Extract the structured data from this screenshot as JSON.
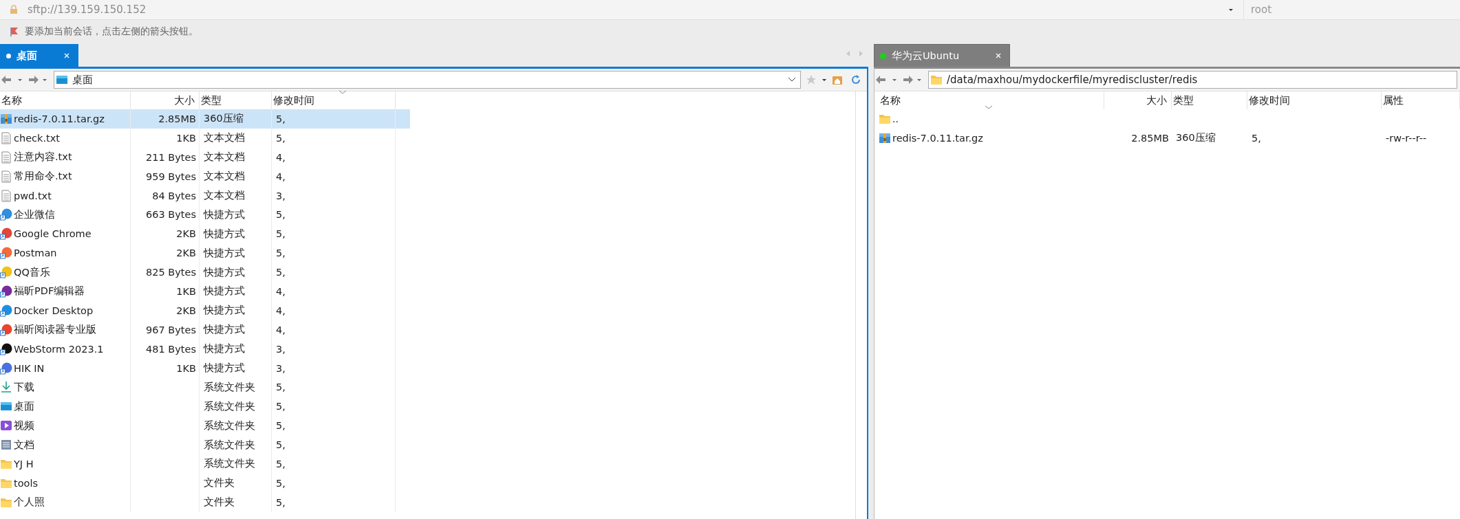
{
  "address_bar": {
    "url": "sftp://139.159.150.152",
    "user": "root"
  },
  "info_bar": {
    "text": "要添加当前会话，点击左侧的箭头按钮。"
  },
  "left_panel": {
    "tab": {
      "label": "桌面",
      "selected": true
    },
    "path": "桌面",
    "columns": [
      "名称",
      "大小",
      "类型",
      "修改时间"
    ],
    "rows": [
      {
        "kind": "archive",
        "name": "redis-7.0.11.tar.gz",
        "size": "2.85MB",
        "type": "360压缩",
        "modified": "5,",
        "selected": true
      },
      {
        "kind": "text",
        "name": "check.txt",
        "size": "1KB",
        "type": "文本文档",
        "modified": "5,",
        "selected": false
      },
      {
        "kind": "text",
        "name": "注意内容.txt",
        "size": "211 Bytes",
        "type": "文本文档",
        "modified": "4,",
        "selected": false
      },
      {
        "kind": "text",
        "name": "常用命令.txt",
        "size": "959 Bytes",
        "type": "文本文档",
        "modified": "4,",
        "selected": false
      },
      {
        "kind": "text",
        "name": "pwd.txt",
        "size": "84 Bytes",
        "type": "文本文档",
        "modified": "3,",
        "selected": false
      },
      {
        "kind": "app",
        "color": "#2f8fe0",
        "name": "企业微信",
        "size": "663 Bytes",
        "type": "快捷方式",
        "modified": "5,",
        "selected": false
      },
      {
        "kind": "app",
        "color": "#e0463a",
        "name": "Google Chrome",
        "size": "2KB",
        "type": "快捷方式",
        "modified": "5,",
        "selected": false
      },
      {
        "kind": "app",
        "color": "#f26b3a",
        "name": "Postman",
        "size": "2KB",
        "type": "快捷方式",
        "modified": "5,",
        "selected": false
      },
      {
        "kind": "app",
        "color": "#f2c21b",
        "name": "QQ音乐",
        "size": "825 Bytes",
        "type": "快捷方式",
        "modified": "5,",
        "selected": false
      },
      {
        "kind": "app",
        "color": "#7a2a9e",
        "name": "福昕PDF编辑器",
        "size": "1KB",
        "type": "快捷方式",
        "modified": "4,",
        "selected": false
      },
      {
        "kind": "app",
        "color": "#1d8fe1",
        "name": "Docker Desktop",
        "size": "2KB",
        "type": "快捷方式",
        "modified": "4,",
        "selected": false
      },
      {
        "kind": "app",
        "color": "#e8452c",
        "name": "福昕阅读器专业版",
        "size": "967 Bytes",
        "type": "快捷方式",
        "modified": "4,",
        "selected": false
      },
      {
        "kind": "app",
        "color": "#111111",
        "name": "WebStorm 2023.1",
        "size": "481 Bytes",
        "type": "快捷方式",
        "modified": "3,",
        "selected": false
      },
      {
        "kind": "app",
        "color": "#4a6fe0",
        "name": "HIK IN",
        "size": "1KB",
        "type": "快捷方式",
        "modified": "3,",
        "selected": false
      },
      {
        "kind": "download",
        "name": "下载",
        "type": "系统文件夹",
        "modified": "5,",
        "selected": false
      },
      {
        "kind": "desktop",
        "name": "桌面",
        "type": "系统文件夹",
        "modified": "5,",
        "selected": false
      },
      {
        "kind": "video",
        "name": "视频",
        "type": "系统文件夹",
        "modified": "5,",
        "selected": false
      },
      {
        "kind": "docs",
        "name": "文档",
        "type": "系统文件夹",
        "modified": "5,",
        "selected": false
      },
      {
        "kind": "folder",
        "name": "YJ H",
        "type": "系统文件夹",
        "modified": "5,",
        "selected": false
      },
      {
        "kind": "folder",
        "name": "tools",
        "type": "文件夹",
        "modified": "5,",
        "selected": false
      },
      {
        "kind": "folder",
        "name": "个人照",
        "type": "文件夹",
        "modified": "5,",
        "selected": false
      }
    ]
  },
  "right_panel": {
    "tab": {
      "label": "华为云Ubuntu",
      "selected": false,
      "connected": true
    },
    "path": "/data/maxhou/mydockerfile/myrediscluster/redis",
    "columns": [
      "名称",
      "大小",
      "类型",
      "修改时间",
      "属性"
    ],
    "rows": [
      {
        "kind": "folder",
        "name": "..",
        "selected": false
      },
      {
        "kind": "archive",
        "name": "redis-7.0.11.tar.gz",
        "size": "2.85MB",
        "type": "360压缩",
        "modified": "5,",
        "attributes": "-rw-r--r--",
        "selected": false
      }
    ]
  }
}
